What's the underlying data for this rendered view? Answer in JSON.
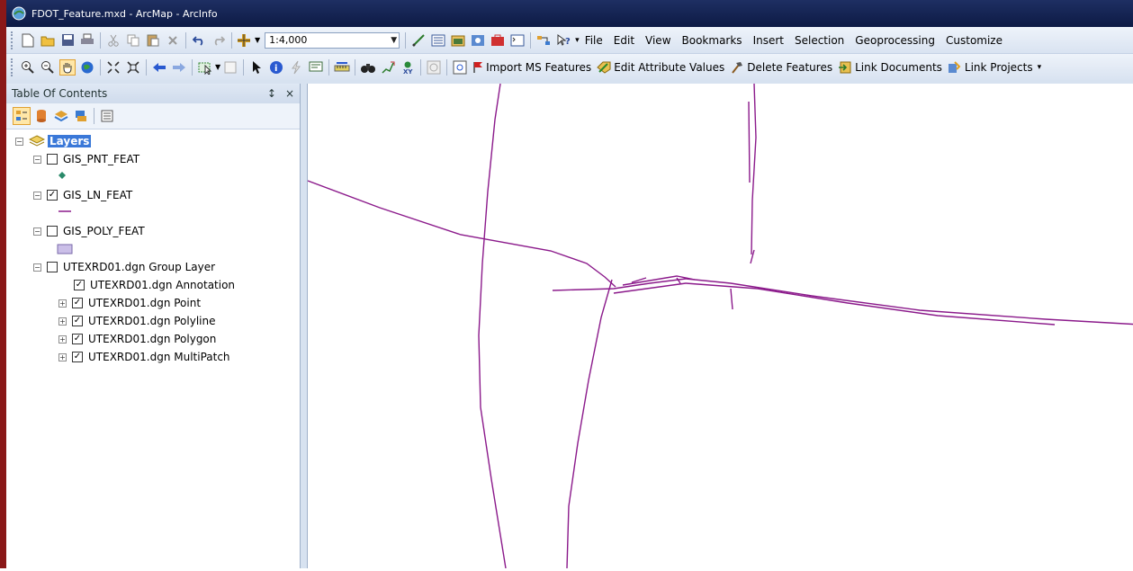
{
  "window": {
    "title": "FDOT_Feature.mxd - ArcMap - ArcInfo"
  },
  "toolbar1": {
    "scale_value": "1:4,000",
    "menu": [
      "File",
      "Edit",
      "View",
      "Bookmarks",
      "Insert",
      "Selection",
      "Geoprocessing",
      "Customize"
    ]
  },
  "toolbar2": {
    "import_label": "Import MS Features",
    "edit_attr_label": "Edit Attribute Values",
    "delete_label": "Delete Features",
    "link_docs_label": "Link Documents",
    "link_projects_label": "Link Projects"
  },
  "toc": {
    "title": "Table Of Contents",
    "pin_glyph": "↕",
    "close_glyph": "×",
    "root_label": "Layers",
    "layers": [
      {
        "label": "GIS_PNT_FEAT",
        "checked": false
      },
      {
        "label": "GIS_LN_FEAT",
        "checked": true
      },
      {
        "label": "GIS_POLY_FEAT",
        "checked": false
      },
      {
        "label": "UTEXRD01.dgn Group Layer",
        "checked": false
      }
    ],
    "sublayers": [
      {
        "label": "UTEXRD01.dgn Annotation",
        "checked": true
      },
      {
        "label": "UTEXRD01.dgn Point",
        "checked": true
      },
      {
        "label": "UTEXRD01.dgn Polyline",
        "checked": true
      },
      {
        "label": "UTEXRD01.dgn Polygon",
        "checked": true
      },
      {
        "label": "UTEXRD01.dgn MultiPatch",
        "checked": true
      }
    ]
  },
  "colors": {
    "line_feature": "#8b1a8b",
    "point_feature": "#2a8a6a",
    "poly_fill": "#cbbfe8"
  }
}
